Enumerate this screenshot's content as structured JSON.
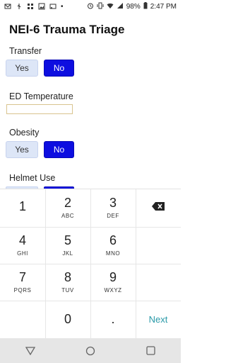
{
  "status_bar": {
    "battery": "98%",
    "time": "2:47 PM"
  },
  "app": {
    "title": "NEI-6 Trauma Triage"
  },
  "fields": {
    "transfer": {
      "label": "Transfer",
      "yes": "Yes",
      "no": "No"
    },
    "ed_temperature": {
      "label": "ED Temperature",
      "value": ""
    },
    "obesity": {
      "label": "Obesity",
      "yes": "Yes",
      "no": "No"
    },
    "helmet_use": {
      "label": "Helmet Use"
    }
  },
  "keypad": {
    "keys": [
      {
        "num": "1",
        "sub": ""
      },
      {
        "num": "2",
        "sub": "ABC"
      },
      {
        "num": "3",
        "sub": "DEF"
      },
      {
        "num": "4",
        "sub": "GHI"
      },
      {
        "num": "5",
        "sub": "JKL"
      },
      {
        "num": "6",
        "sub": "MNO"
      },
      {
        "num": "7",
        "sub": "PQRS"
      },
      {
        "num": "8",
        "sub": "TUV"
      },
      {
        "num": "9",
        "sub": "WXYZ"
      },
      {
        "num": "0",
        "sub": ""
      },
      {
        "num": ".",
        "sub": ""
      }
    ],
    "next_label": "Next",
    "backspace_icon": "backspace-icon"
  },
  "colors": {
    "accent": "#0d0ee0",
    "yes_bg": "#dde6f7",
    "next": "#2a9aa8"
  }
}
